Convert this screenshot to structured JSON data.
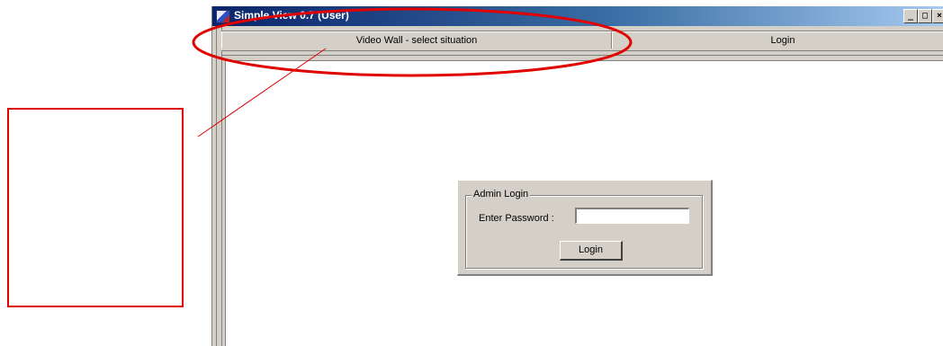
{
  "window": {
    "title": "Simple View 0.7 (User)",
    "controls": {
      "minimize": "_",
      "maximize": "□",
      "close": "×"
    }
  },
  "tabs": [
    {
      "label": "Video Wall - select situation",
      "selected": true
    },
    {
      "label": "Login",
      "selected": false
    }
  ],
  "login_panel": {
    "group_title": "Admin Login",
    "password_label": "Enter Password :",
    "password_value": "",
    "login_button": "Login"
  },
  "annotation": {
    "color": "#e00000",
    "highlight": "ellipse around tab bar",
    "callout": "empty red box connected by line"
  },
  "colors": {
    "titlebar_start": "#0a246a",
    "titlebar_end": "#a6caf0",
    "face": "#d4d0c8"
  }
}
